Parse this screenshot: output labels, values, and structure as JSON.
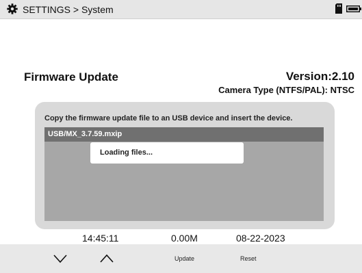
{
  "header": {
    "breadcrumb": "SETTINGS > System",
    "icons": [
      "gear-icon",
      "sd-card-icon",
      "battery-icon"
    ]
  },
  "firmware": {
    "title": "Firmware Update",
    "version": "Version:2.10",
    "camera_type": "Camera Type (NTFS/PAL): NTSC",
    "instruction": "Copy the firmware update file to an USB device and insert the device.",
    "files": [
      "USB/MX_3.7.59.mxip"
    ],
    "loading_message": "Loading files..."
  },
  "status": {
    "time": "14:45:11",
    "size": "0.00M",
    "date": "08-22-2023"
  },
  "toolbar": {
    "down_icon": "chevron-down-icon",
    "up_icon": "chevron-up-icon",
    "update_label": "Update",
    "reset_label": "Reset"
  },
  "colors": {
    "topbar": "#e6e6e6",
    "panel": "#d9d9d9",
    "file_list": "#a7a7a7",
    "selected_row": "#707070",
    "bottombar": "#e8e8e8"
  }
}
